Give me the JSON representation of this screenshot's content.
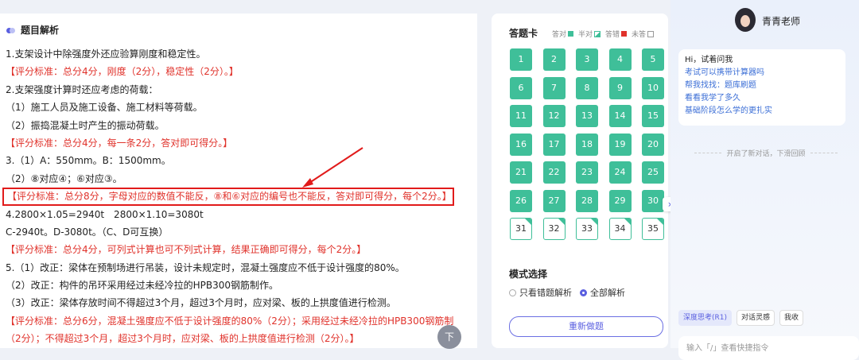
{
  "section": {
    "title": "题目解析"
  },
  "analysis_lines": [
    {
      "text": "1.支架设计中除强度外还应验算刚度和稳定性。",
      "type": "normal"
    },
    {
      "text": "【评分标准：总分4分，刚度（2分），稳定性（2分）。】",
      "type": "red"
    },
    {
      "text": "2.支架强度计算时还应考虑的荷载：",
      "type": "normal"
    },
    {
      "text": "（1）施工人员及施工设备、施工材料等荷载。",
      "type": "normal"
    },
    {
      "text": "（2）振捣混凝土时产生的振动荷载。",
      "type": "normal"
    },
    {
      "text": "【评分标准：总分4分，每一条2分，答对即可得分。】",
      "type": "red"
    },
    {
      "text": "3.（1）A：550mm。B：1500mm。",
      "type": "normal"
    },
    {
      "text": "（2）⑧对应④；⑥对应③。",
      "type": "normal"
    },
    {
      "text": "【评分标准：总分8分，字母对应的数值不能反，⑧和⑥对应的编号也不能反，答对即可得分，每个2分。】",
      "type": "red-box"
    },
    {
      "text": "4.2800×1.05=2940t　2800×1.10=3080t",
      "type": "normal"
    },
    {
      "text": "C-2940t。D-3080t。（C、D可互换）",
      "type": "normal"
    },
    {
      "text": "【评分标准：总分4分，可列式计算也可不列式计算，结果正确即可得分，每个2分。】",
      "type": "red"
    },
    {
      "text": "5.（1）改正：梁体在预制场进行吊装，设计未规定时，混凝土强度应不低于设计强度的80%。",
      "type": "normal"
    },
    {
      "text": "（2）改正：构件的吊环采用经过未经冷拉的HPB300钢筋制作。",
      "type": "normal"
    },
    {
      "text": "（3）改正：梁体存放时间不得超过3个月，超过3个月时，应对梁、板的上拱度值进行检测。",
      "type": "normal"
    },
    {
      "text": "【评分标准：总分6分，混凝土强度应不低于设计强度的80%（2分）；采用经过未经冷拉的HPB300钢筋制",
      "type": "red"
    },
    {
      "text": "（2分）；不得超过3个月，超过3个月时，应对梁、板的上拱度值进行检测（2分）。】",
      "type": "red"
    }
  ],
  "float_button": {
    "label": "下"
  },
  "answer_card": {
    "title": "答题卡",
    "legend": {
      "correct": "答对",
      "half": "半对",
      "wrong": "答错",
      "unanswered": "未答"
    },
    "questions": [
      {
        "n": "1",
        "s": "correct"
      },
      {
        "n": "2",
        "s": "correct"
      },
      {
        "n": "3",
        "s": "correct"
      },
      {
        "n": "4",
        "s": "correct"
      },
      {
        "n": "5",
        "s": "correct"
      },
      {
        "n": "6",
        "s": "correct"
      },
      {
        "n": "7",
        "s": "correct"
      },
      {
        "n": "8",
        "s": "correct"
      },
      {
        "n": "9",
        "s": "correct"
      },
      {
        "n": "10",
        "s": "correct"
      },
      {
        "n": "11",
        "s": "correct"
      },
      {
        "n": "12",
        "s": "correct"
      },
      {
        "n": "13",
        "s": "correct"
      },
      {
        "n": "14",
        "s": "correct"
      },
      {
        "n": "15",
        "s": "correct"
      },
      {
        "n": "16",
        "s": "correct"
      },
      {
        "n": "17",
        "s": "correct"
      },
      {
        "n": "18",
        "s": "correct"
      },
      {
        "n": "19",
        "s": "correct"
      },
      {
        "n": "20",
        "s": "correct"
      },
      {
        "n": "21",
        "s": "correct"
      },
      {
        "n": "22",
        "s": "correct"
      },
      {
        "n": "23",
        "s": "correct"
      },
      {
        "n": "24",
        "s": "correct"
      },
      {
        "n": "25",
        "s": "correct"
      },
      {
        "n": "26",
        "s": "correct"
      },
      {
        "n": "27",
        "s": "correct"
      },
      {
        "n": "28",
        "s": "correct"
      },
      {
        "n": "29",
        "s": "correct"
      },
      {
        "n": "30",
        "s": "correct"
      },
      {
        "n": "31",
        "s": "half"
      },
      {
        "n": "32",
        "s": "half"
      },
      {
        "n": "33",
        "s": "half"
      },
      {
        "n": "34",
        "s": "half"
      },
      {
        "n": "35",
        "s": "half"
      }
    ],
    "mode_title": "模式选择",
    "mode_options": [
      "只看错题解析",
      "全部解析"
    ],
    "mode_selected": "全部解析",
    "redo_label": "重新做题",
    "colors": {
      "correct": "#3fbf99",
      "wrong": "#e0322b",
      "accent": "#5a5fe0"
    }
  },
  "chat": {
    "teacher_name": "青青老师",
    "greeting": "Hi，试着问我",
    "suggestions": [
      "考试可以携带计算器吗",
      "帮我找找：题库刷题",
      "看看我学了多久",
      "基础阶段怎么学的更扎实"
    ],
    "divider": "开启了新对话，下滑回顾",
    "chips": [
      "深度思考(R1)",
      "对话灵感",
      "我收"
    ],
    "input_placeholder": "输入「/」查看快捷指令"
  }
}
